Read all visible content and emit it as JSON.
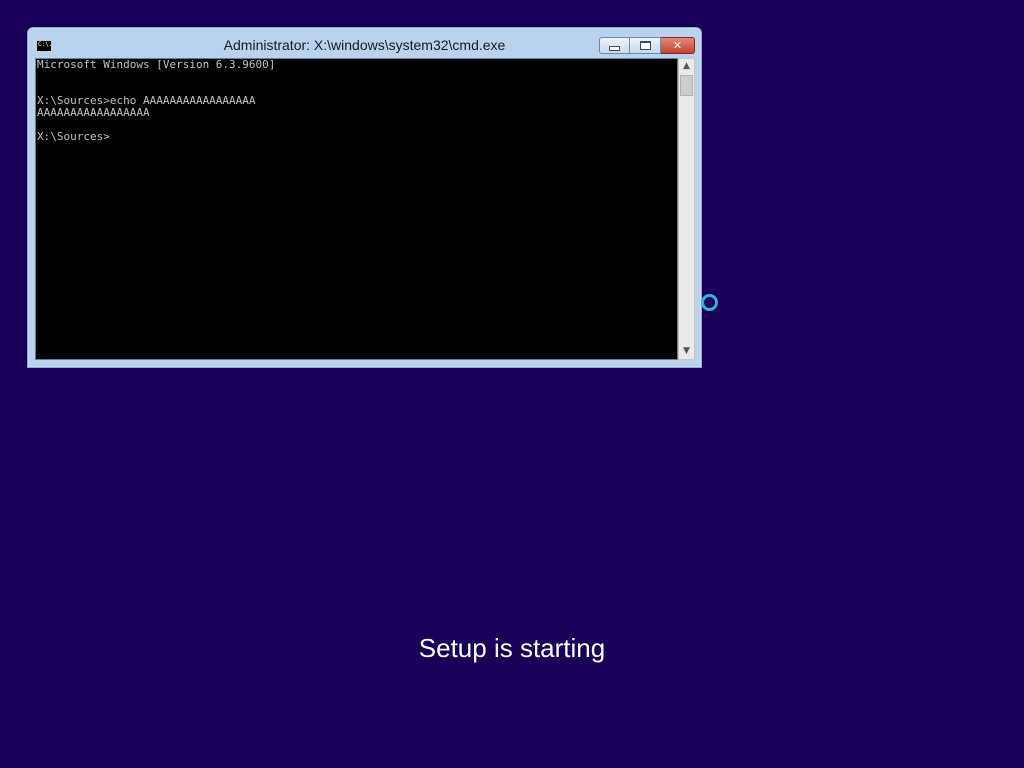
{
  "window": {
    "title": "Administrator: X:\\windows\\system32\\cmd.exe",
    "icon": "cmd-prompt-icon",
    "icon_text": "C:\\.",
    "buttons": {
      "minimize": "minimize-icon",
      "maximize": "maximize-icon",
      "close_label": "✕"
    }
  },
  "console": {
    "lines": [
      "Microsoft Windows [Version 6.3.9600]",
      "",
      "",
      "X:\\Sources>echo AAAAAAAAAAAAAAAAA",
      "AAAAAAAAAAAAAAAAA",
      "",
      "X:\\Sources>"
    ],
    "scroll": {
      "up": "▲",
      "down": "▼"
    }
  },
  "setup": {
    "status": "Setup is starting",
    "spinner": "loading-spinner-icon"
  },
  "colors": {
    "desktop_background": "#180059",
    "console_background": "#000000",
    "console_text": "#c0c0c0",
    "window_frame": "#b9d3ee",
    "spinner": "#31b4d6"
  }
}
